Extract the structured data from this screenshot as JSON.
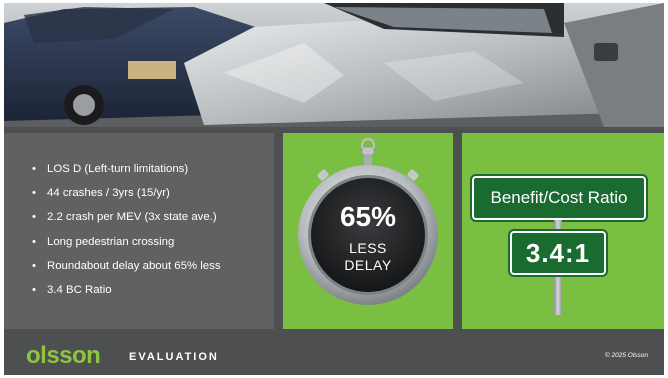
{
  "bullets": [
    "LOS D (Left-turn limitations)",
    "44 crashes / 3yrs (15/yr)",
    "2.2 crash per MEV (3x state ave.)",
    "Long pedestrian crossing",
    "Roundabout delay about 65% less",
    "3.4 BC Ratio"
  ],
  "stopwatch": {
    "percent": "65%",
    "line1": "LESS",
    "line2": "DELAY"
  },
  "sign": {
    "title": "Benefit/Cost Ratio",
    "value": "3.4:1"
  },
  "footer": {
    "logo": "olsson",
    "section": "EVALUATION",
    "copyright": "© 2025 Olsson"
  },
  "colors": {
    "panel_green": "#7bbf42",
    "sign_green": "#1a6b2f",
    "logo_green": "#8cc63f",
    "dark_gray": "#4d4f51"
  }
}
